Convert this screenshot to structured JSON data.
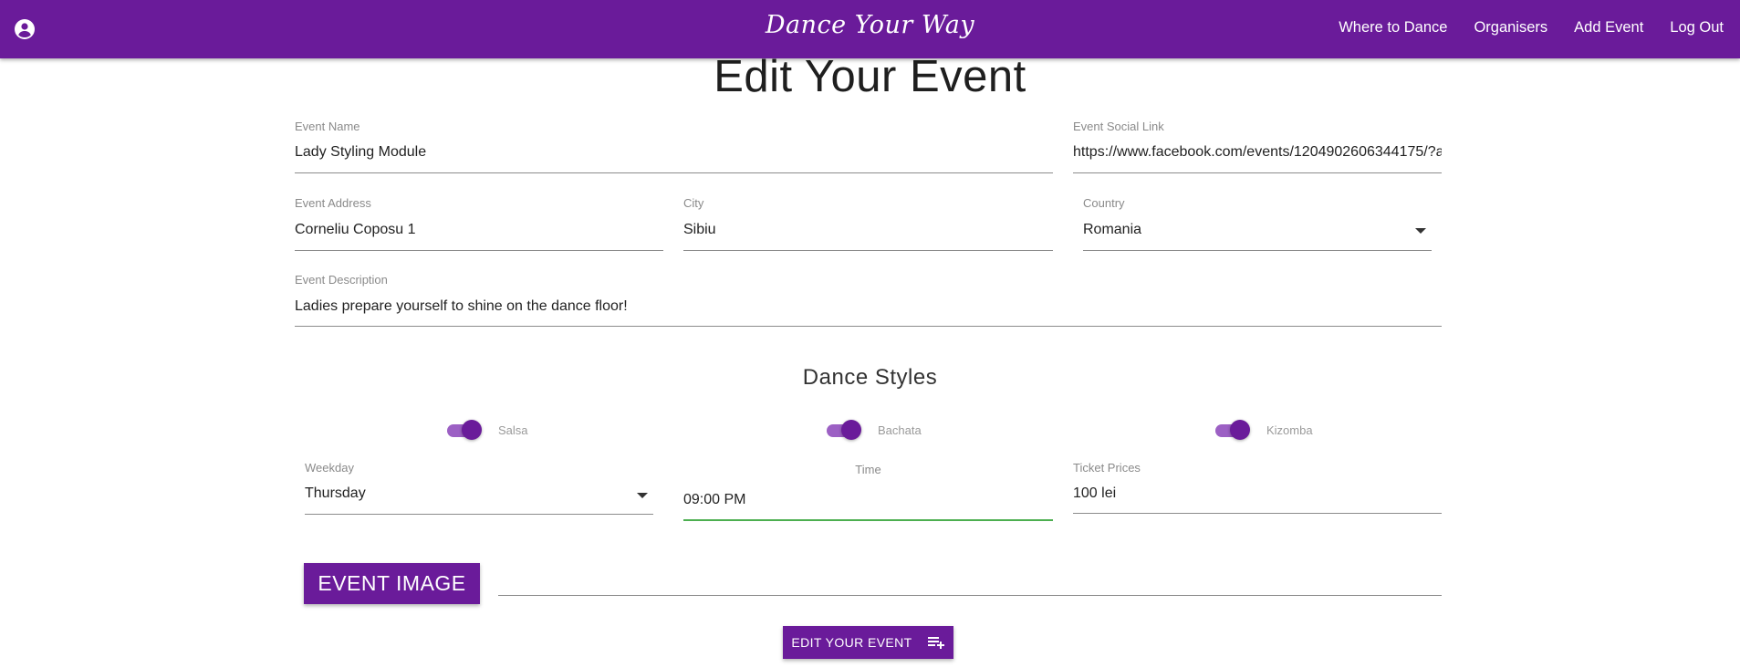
{
  "header": {
    "brand": "Dance Your Way",
    "nav": [
      "Where to Dance",
      "Organisers",
      "Add Event",
      "Log Out"
    ],
    "account_icon": "account-circle-icon",
    "color": "#6a1b9a"
  },
  "page": {
    "title": "Edit Your Event"
  },
  "form": {
    "event_name": {
      "label": "Event Name",
      "value": "Lady Styling Module"
    },
    "social_link": {
      "label": "Event Social Link",
      "value": "https://www.facebook.com/events/1204902606344175/?a"
    },
    "address": {
      "label": "Event Address",
      "value": "Corneliu Coposu 1"
    },
    "city": {
      "label": "City",
      "value": "Sibiu"
    },
    "country": {
      "label": "Country",
      "value": "Romania"
    },
    "description": {
      "label": "Event Description",
      "value": "Ladies prepare yourself to shine on the dance floor!"
    },
    "dance_styles": {
      "title": "Dance Styles",
      "items": [
        {
          "label": "Salsa",
          "on": true
        },
        {
          "label": "Bachata",
          "on": true
        },
        {
          "label": "Kizomba",
          "on": true
        }
      ]
    },
    "weekday": {
      "label": "Weekday",
      "value": "Thursday"
    },
    "time": {
      "label": "Time",
      "value": "09:00 PM",
      "focus_color": "#4caf50"
    },
    "ticket_prices": {
      "label": "Ticket Prices",
      "value": "100 lei"
    },
    "image_button": "EVENT IMAGE",
    "submit_button": "EDIT YOUR EVENT",
    "submit_icon": "playlist-add-icon"
  }
}
